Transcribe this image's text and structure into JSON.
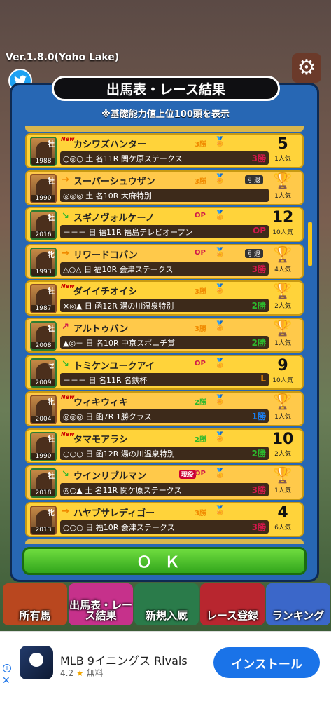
{
  "version": "Ver.1.8.0(Yoho Lake)",
  "header": {
    "title": "出馬表・レース結果",
    "subtitle": "※基礎能力値上位100頭を表示"
  },
  "icons": {
    "twitter": "twitter-bird-icon",
    "settings": "gear-icon"
  },
  "horses": [
    {
      "name": "カシワズハンター",
      "sex": "牡",
      "year": "1988",
      "new": "New",
      "arrow": "",
      "grade": "3勝",
      "status": "",
      "retired": "",
      "race": "○◎○ 土 名11R 関ケ原ステークス",
      "result": "3勝",
      "rank": "5",
      "rank_type": "laurel",
      "pop": "1人気"
    },
    {
      "name": "スーパーシュウザン",
      "sex": "牡",
      "year": "1990",
      "new": "",
      "arrow": "→",
      "grade": "3勝",
      "status": "",
      "retired": "引退",
      "race": "◎◎◎ 土 名10R 大府特別",
      "result": "",
      "rank": "1",
      "rank_type": "trophy",
      "pop": "1人気"
    },
    {
      "name": "スギノヴォルケーノ",
      "sex": "牡",
      "year": "2016",
      "new": "",
      "arrow": "↘",
      "grade": "OP",
      "status": "",
      "retired": "",
      "race": "－－－ 日 福11R 福島テレビオープン",
      "result": "OP",
      "rank": "12",
      "rank_type": "number",
      "pop": "10人気"
    },
    {
      "name": "リワードコパン",
      "sex": "牝",
      "year": "1993",
      "new": "",
      "arrow": "→",
      "grade": "OP",
      "status": "",
      "retired": "引退",
      "race": "△○△ 日 福10R 会津ステークス",
      "result": "3勝",
      "rank": "1",
      "rank_type": "trophy",
      "pop": "4人気"
    },
    {
      "name": "ダイイチオイシ",
      "sex": "牡",
      "year": "1987",
      "new": "New",
      "arrow": "",
      "grade": "3勝",
      "status": "",
      "retired": "",
      "race": "×◎▲ 日 函12R 湯の川温泉特別",
      "result": "2勝",
      "rank": "1",
      "rank_type": "trophy",
      "pop": "2人気"
    },
    {
      "name": "アルトゥバン",
      "sex": "牡",
      "year": "2008",
      "new": "",
      "arrow": "↗",
      "grade": "3勝",
      "status": "",
      "retired": "",
      "race": "▲◎－ 日 名10R 中京スポニチ賞",
      "result": "2勝",
      "rank": "1",
      "rank_type": "trophy",
      "pop": "1人気"
    },
    {
      "name": "トミケンユークアイ",
      "sex": "セ",
      "year": "2009",
      "new": "",
      "arrow": "↘",
      "grade": "OP",
      "status": "",
      "retired": "",
      "race": "－－－ 日 名11R 名鉄杯",
      "result": "L",
      "rank": "9",
      "rank_type": "number",
      "pop": "10人気"
    },
    {
      "name": "ウィキウィキ",
      "sex": "牝",
      "year": "2004",
      "new": "New",
      "arrow": "",
      "grade": "2勝",
      "status": "",
      "retired": "",
      "race": "◎◎◎ 日 函7R 1勝クラス",
      "result": "1勝",
      "rank": "1",
      "rank_type": "trophy",
      "pop": "1人気"
    },
    {
      "name": "タマモアラシ",
      "sex": "牡",
      "year": "1990",
      "new": "New",
      "arrow": "",
      "grade": "2勝",
      "status": "",
      "retired": "",
      "race": "○○○ 日 函12R 湯の川温泉特別",
      "result": "2勝",
      "rank": "10",
      "rank_type": "number",
      "pop": "2人気"
    },
    {
      "name": "ウインリブルマン",
      "sex": "牡",
      "year": "2018",
      "new": "",
      "arrow": "↘",
      "grade": "OP",
      "status": "現役",
      "retired": "",
      "race": "◎○▲ 土 名11R 関ケ原ステークス",
      "result": "3勝",
      "rank": "1",
      "rank_type": "trophy",
      "pop": "1人気"
    },
    {
      "name": "ハヤブサレディゴー",
      "sex": "牝",
      "year": "2013",
      "new": "",
      "arrow": "→",
      "grade": "3勝",
      "status": "",
      "retired": "",
      "race": "○○○ 日 福10R 会津ステークス",
      "result": "3勝",
      "rank": "4",
      "rank_type": "laurel",
      "pop": "6人気"
    }
  ],
  "ok_label": "ＯＫ",
  "nav": [
    {
      "label": "所有馬",
      "color": "#b9471f"
    },
    {
      "label": "出馬表・レース結果",
      "color": "#c6318b"
    },
    {
      "label": "新規入厩",
      "color": "#2a7b4a"
    },
    {
      "label": "レース登録",
      "color": "#b8262f"
    },
    {
      "label": "ランキング",
      "color": "#3b67c9"
    }
  ],
  "ad": {
    "title": "MLB 9イニングス Rivals",
    "rating": "4.2",
    "star": "★",
    "price": "無料",
    "install": "インストール",
    "info": "i",
    "close": "✕",
    "icon_label": "com2us"
  },
  "colors": {
    "panel": "#2767b4",
    "row": "#ffd33a",
    "ok": "#3fbf28",
    "install": "#1a73e8"
  }
}
